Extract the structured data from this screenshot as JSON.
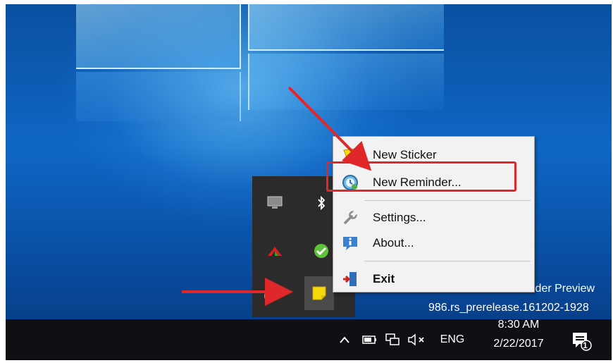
{
  "context_menu": {
    "items": [
      {
        "label": "New Sticker",
        "icon": "sticker-icon"
      },
      {
        "label": "New Reminder...",
        "icon": "reminder-clock-icon"
      },
      {
        "label": "Settings...",
        "icon": "wrench-icon"
      },
      {
        "label": "About...",
        "icon": "info-icon"
      },
      {
        "label": "Exit",
        "icon": "exit-door-icon"
      }
    ],
    "highlighted_item": "New Reminder..."
  },
  "watermark": {
    "line1": "sider Preview",
    "line2": "986.rs_prerelease.161202-1928"
  },
  "taskbar": {
    "language": "ENG",
    "time": "8:30 AM",
    "date": "2/22/2017",
    "notification_count": "1"
  },
  "colors": {
    "annotation_red": "#e0282a",
    "taskbar": "#0f0f14",
    "menu_bg": "#f2f2f2",
    "desktop_blue": "#0b5fb0"
  }
}
